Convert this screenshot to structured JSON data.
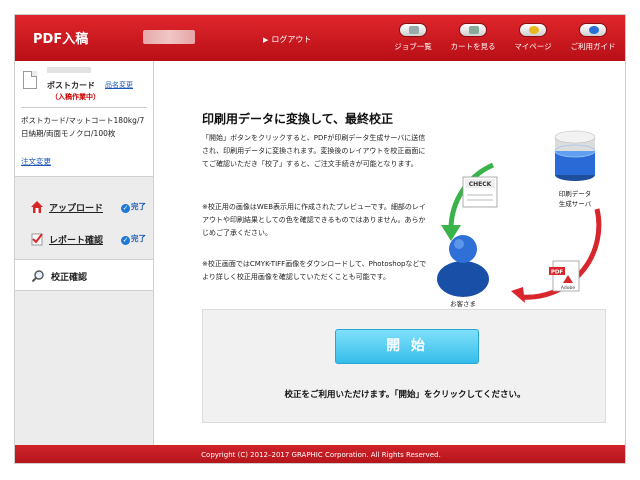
{
  "header": {
    "brand": "PDF入稿",
    "logout": "ログアウト",
    "nav": [
      {
        "label": "ジョブ一覧",
        "icon": "job-list-icon"
      },
      {
        "label": "カートを見る",
        "icon": "cart-icon"
      },
      {
        "label": "マイページ",
        "icon": "mypage-icon"
      },
      {
        "label": "ご利用ガイド",
        "icon": "help-icon"
      }
    ]
  },
  "sidebar": {
    "product_name": "ポストカード",
    "change_product": "品名変更",
    "status": "（入稿作業中）",
    "spec": "ポストカード/マットコート180kg/7日納期/両面モノクロ/100枚",
    "order_change": "注文変更",
    "steps": [
      {
        "label": "アップロード",
        "done": "完了"
      },
      {
        "label": "レポート確認",
        "done": "完了"
      },
      {
        "label": "校正確認"
      }
    ]
  },
  "main": {
    "title": "印刷用データに変換して、最終校正",
    "para1": "「開始」ボタンをクリックすると、PDFが印刷データ生成サーバに送信され、印刷用データに変換されます。変換後のレイアウトを校正画面にてご確認いただき「校了」すると、ご注文手続きが可能となります。",
    "para2": "※校正用の画像はWEB表示用に作成されたプレビューです。細部のレイアウトや印刷結果としての色を確認できるものではありません。あらかじめご了承ください。",
    "para3": "※校正画面ではCMYK-TIFF画像をダウンロードして、Photoshopなどでより詳しく校正用画像を確認していただくことも可能です。",
    "diagram": {
      "server_label_1": "印刷データ",
      "server_label_2": "生成サーバ",
      "customer_label": "お客さま",
      "check_label": "CHECK",
      "pdf_label": "PDF",
      "adobe_label": "Adobe"
    },
    "start_button": "開 始",
    "start_message": "校正をご利用いただけます。「開始」をクリックしてください。"
  },
  "footer": {
    "copyright": "Copyright (C) 2012–2017 GRAPHIC Corporation. All Rights Reserved."
  }
}
